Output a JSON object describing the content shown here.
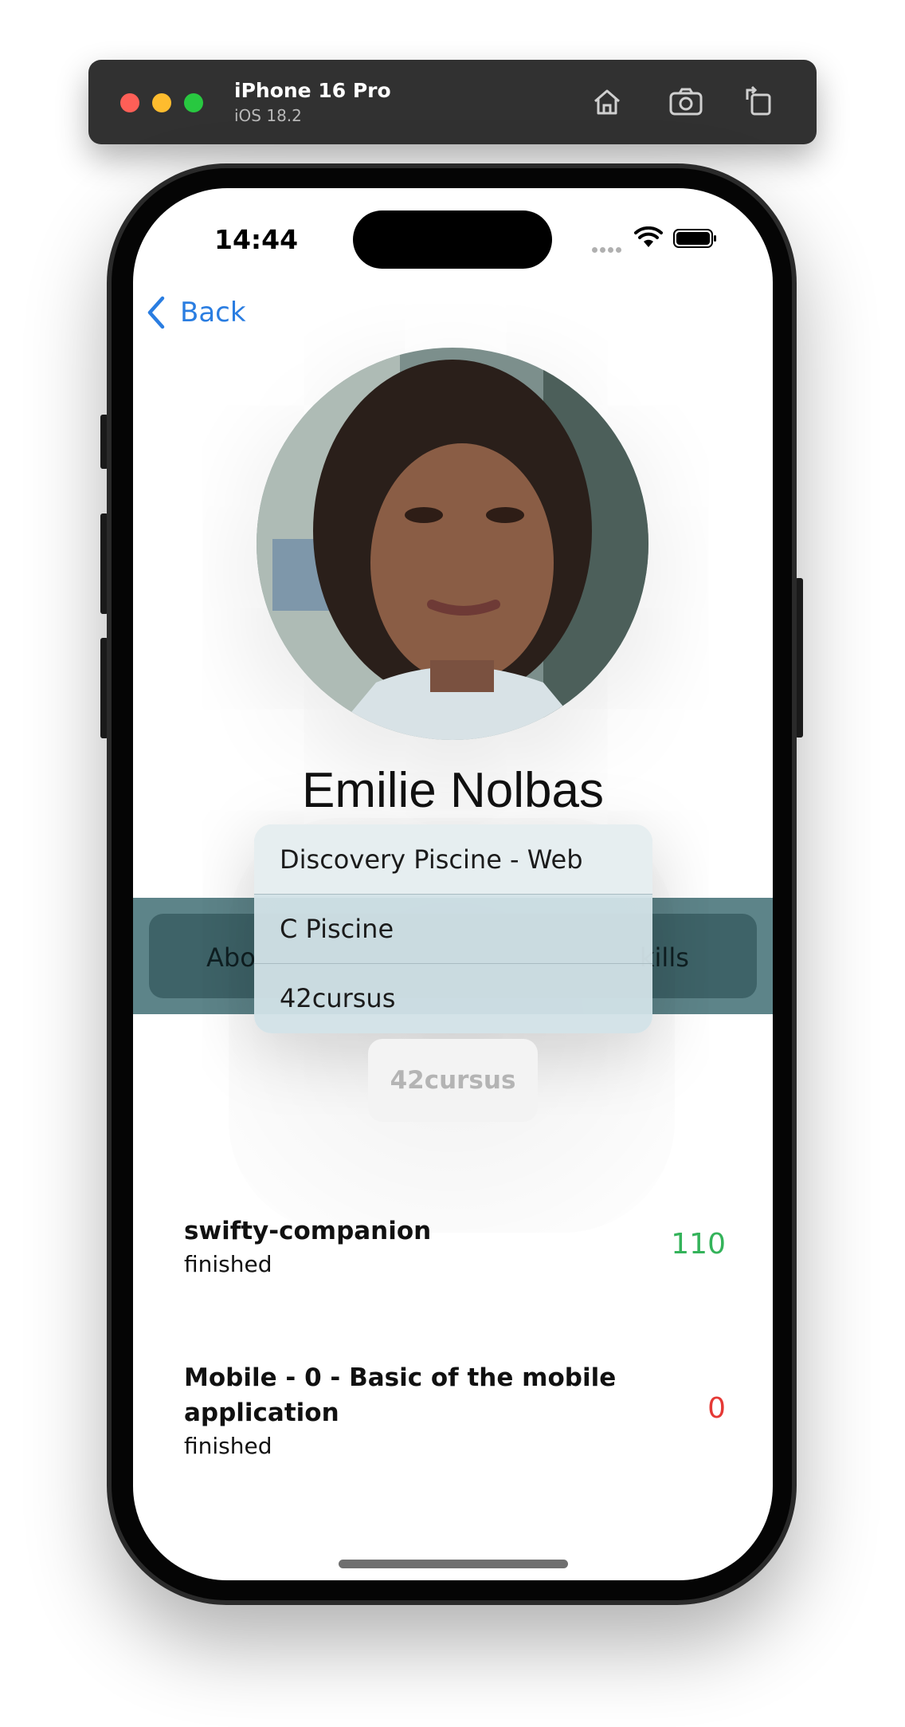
{
  "simulator": {
    "device_name": "iPhone 16 Pro",
    "os_version": "iOS 18.2",
    "icons": [
      "home-icon",
      "screenshot-icon",
      "rotate-icon"
    ]
  },
  "status_bar": {
    "time": "14:44",
    "icons": [
      "cellular-icon",
      "wifi-icon",
      "battery-icon"
    ]
  },
  "nav": {
    "back_label": "Back",
    "back_icon": "chevron-left-icon",
    "accent_color": "#2a7de1"
  },
  "profile": {
    "name": "Emilie Nolbas"
  },
  "tabs": {
    "about_label": "Abo",
    "skills_label": "kills",
    "band_color": "#5d8489"
  },
  "cursus_menu": {
    "items": [
      "Discovery Piscine - Web",
      "C Piscine",
      "42cursus"
    ],
    "selected": "42cursus"
  },
  "projects": [
    {
      "name": "swifty-companion",
      "status": "finished",
      "score": "110",
      "score_color": "#34b35a"
    },
    {
      "name": "Mobile - 0 - Basic of the mobile application",
      "status": "finished",
      "score": "0",
      "score_color": "#e53935"
    }
  ]
}
